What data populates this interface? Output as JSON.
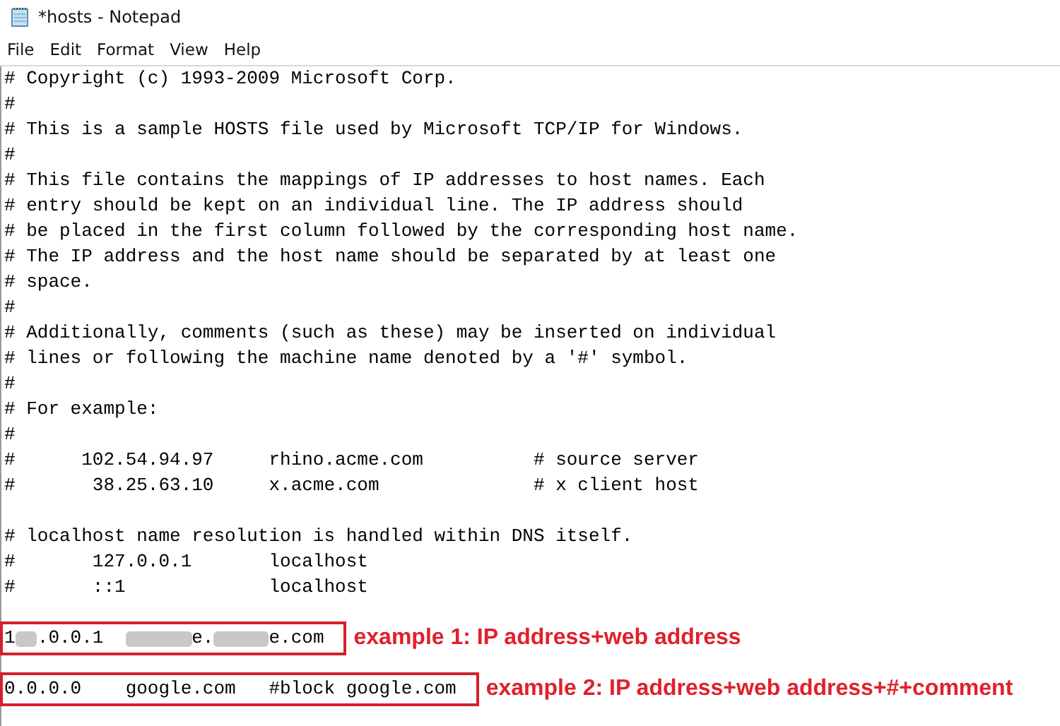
{
  "window": {
    "title": "*hosts - Notepad"
  },
  "menu": [
    "File",
    "Edit",
    "Format",
    "View",
    "Help"
  ],
  "lines": [
    {
      "text": "# Copyright (c) 1993-2009 Microsoft Corp."
    },
    {
      "text": "#"
    },
    {
      "text": "# This is a sample HOSTS file used by Microsoft TCP/IP for Windows."
    },
    {
      "text": "#"
    },
    {
      "text": "# This file contains the mappings of IP addresses to host names. Each"
    },
    {
      "text": "# entry should be kept on an individual line. The IP address should"
    },
    {
      "text": "# be placed in the first column followed by the corresponding host name."
    },
    {
      "text": "# The IP address and the host name should be separated by at least one"
    },
    {
      "text": "# space."
    },
    {
      "text": "#"
    },
    {
      "text": "# Additionally, comments (such as these) may be inserted on individual"
    },
    {
      "text": "# lines or following the machine name denoted by a '#' symbol."
    },
    {
      "text": "#"
    },
    {
      "text": "# For example:"
    },
    {
      "text": "#"
    },
    {
      "text": "#      102.54.94.97     rhino.acme.com          # source server"
    },
    {
      "text": "#       38.25.63.10     x.acme.com              # x client host"
    },
    {
      "kind": "blank"
    },
    {
      "text": "# localhost name resolution is handled within DNS itself."
    },
    {
      "text": "#       127.0.0.1       localhost"
    },
    {
      "text": "#       ::1             localhost"
    },
    {
      "kind": "blank"
    },
    {
      "segments": [
        {
          "kind": "text",
          "text": "1"
        },
        {
          "kind": "blur"
        },
        {
          "kind": "text",
          "text": ".0.0.1  "
        },
        {
          "kind": "blur"
        },
        {
          "kind": "text",
          "text": "e."
        },
        {
          "kind": "blur"
        },
        {
          "kind": "text",
          "text": "e.com"
        }
      ],
      "annotation": "example 1: IP address+web address"
    },
    {
      "kind": "blank"
    },
    {
      "text": "0.0.0.0    google.com   #block google.com",
      "annotation": "example 2: IP address+web address+#+comment"
    }
  ]
}
